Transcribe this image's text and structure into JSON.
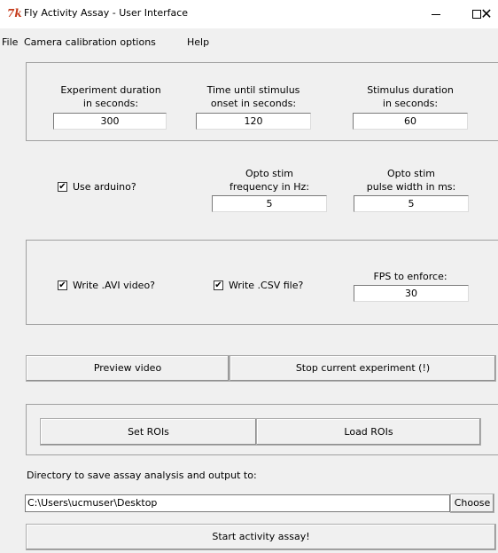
{
  "window": {
    "title": "Fly Activity Assay - User Interface",
    "icon": "tk-feather-icon",
    "icon_glyph": "7k",
    "min_glyph": "",
    "close_glyph": "✕"
  },
  "menu": [
    "File",
    "Camera calibration options",
    "Help"
  ],
  "timing": {
    "duration_label_1": "Experiment duration",
    "duration_label_2": "in seconds:",
    "duration_value": "300",
    "onset_label_1": "Time until stimulus",
    "onset_label_2": "onset in seconds:",
    "onset_value": "120",
    "stim_label_1": "Stimulus duration",
    "stim_label_2": "in seconds:",
    "stim_value": "60"
  },
  "opto": {
    "arduino_label": "Use arduino?",
    "arduino_checked": true,
    "freq_label_1": "Opto stim",
    "freq_label_2": "frequency in Hz:",
    "freq_value": "5",
    "pulse_label_1": "Opto stim",
    "pulse_label_2": "pulse width in ms:",
    "pulse_value": "5"
  },
  "output": {
    "avi_label": "Write .AVI video?",
    "avi_checked": true,
    "csv_label": "Write .CSV file?",
    "csv_checked": true,
    "fps_label": "FPS to enforce:",
    "fps_value": "30"
  },
  "actions": {
    "preview_label": "Preview video",
    "stop_label": "Stop current experiment (!)"
  },
  "rois": {
    "set_label": "Set ROIs",
    "load_label": "Load ROIs"
  },
  "directory": {
    "label": "Directory to save assay analysis and output to:",
    "value": "C:\\Users\\ucmuser\\Desktop",
    "choose_label": "Choose"
  },
  "start": {
    "label": "Start activity assay!"
  },
  "check_glyph": "✔"
}
